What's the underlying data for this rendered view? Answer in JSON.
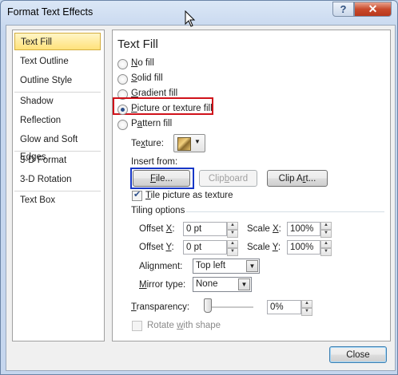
{
  "window": {
    "title": "Format Text Effects",
    "help_label": "?",
    "close_label": "✕"
  },
  "nav": {
    "items": [
      "Text Fill",
      "Text Outline",
      "Outline Style",
      "Shadow",
      "Reflection",
      "Glow and Soft Edges",
      "3-D Format",
      "3-D Rotation",
      "Text Box"
    ],
    "selected": "Text Fill"
  },
  "panel": {
    "heading": "Text Fill",
    "fill_options": [
      {
        "pre": "",
        "key": "N",
        "post": "o fill",
        "selected": false
      },
      {
        "pre": "",
        "key": "S",
        "post": "olid fill",
        "selected": false
      },
      {
        "pre": "",
        "key": "G",
        "post": "radient fill",
        "selected": false
      },
      {
        "pre": "",
        "key": "P",
        "post": "icture or texture fill",
        "selected": true
      },
      {
        "pre": "P",
        "key": "a",
        "post": "ttern fill",
        "selected": false
      }
    ],
    "texture_label_pre": "Te",
    "texture_label_key": "x",
    "texture_label_post": "ture:",
    "insert_from": "Insert from:",
    "file_pre": "",
    "file_key": "F",
    "file_post": "ile...",
    "clipboard_pre": "Clip",
    "clipboard_key": "b",
    "clipboard_post": "oard",
    "clipart_pre": "Clip A",
    "clipart_key": "r",
    "clipart_post": "t...",
    "tile_pre": "",
    "tile_key": "T",
    "tile_post": "ile picture as texture",
    "tile_checked": true,
    "tiling_options": "Tiling options",
    "offset_x": {
      "pre": "Offset ",
      "key": "X",
      "post": ":",
      "value": "0 pt"
    },
    "offset_y": {
      "pre": "Offset ",
      "key": "Y",
      "post": ":",
      "value": "0 pt"
    },
    "scale_x": {
      "pre": "Scale ",
      "key": "X",
      "post": ":",
      "value": "100%"
    },
    "scale_y": {
      "pre": "Scale ",
      "key": "Y",
      "post": ":",
      "value": "100%"
    },
    "alignment": {
      "pre": "Ali",
      "key": "g",
      "post": "nment:",
      "value": "Top left"
    },
    "mirror": {
      "pre": "",
      "key": "M",
      "post": "irror type:",
      "value": "None"
    },
    "transparency": {
      "pre": "",
      "key": "T",
      "post": "ransparency:",
      "value": "0%",
      "level": 0
    },
    "rotate_pre": "Rotate ",
    "rotate_key": "w",
    "rotate_post": "ith shape"
  },
  "footer": {
    "close_label": "Close"
  },
  "colors": {
    "highlight_red": "#d0121a",
    "highlight_blue": "#1737c7"
  }
}
